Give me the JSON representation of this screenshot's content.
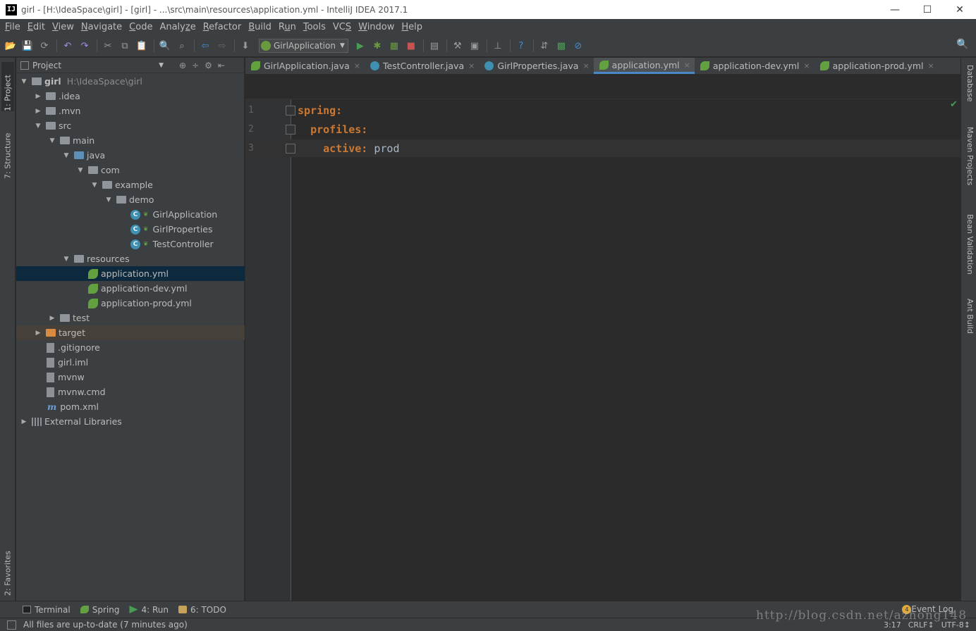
{
  "window": {
    "title": "girl - [H:\\IdeaSpace\\girl] - [girl] - ...\\src\\main\\resources\\application.yml - IntelliJ IDEA 2017.1",
    "app_icon_text": "IJ",
    "minimize": "—",
    "maximize": "☐",
    "close": "✕"
  },
  "menu": [
    {
      "mnemonic": "F",
      "rest": "ile"
    },
    {
      "mnemonic": "E",
      "rest": "dit"
    },
    {
      "mnemonic": "V",
      "rest": "iew"
    },
    {
      "mnemonic": "N",
      "rest": "avigate"
    },
    {
      "mnemonic": "C",
      "rest": "ode"
    },
    {
      "prefix": "Analy",
      "mnemonic": "z",
      "rest": "e"
    },
    {
      "mnemonic": "R",
      "rest": "efactor"
    },
    {
      "mnemonic": "B",
      "rest": "uild"
    },
    {
      "prefix": "R",
      "mnemonic": "u",
      "rest": "n"
    },
    {
      "mnemonic": "T",
      "rest": "ools"
    },
    {
      "prefix": "VC",
      "mnemonic": "S",
      "rest": ""
    },
    {
      "mnemonic": "W",
      "rest": "indow"
    },
    {
      "mnemonic": "H",
      "rest": "elp"
    }
  ],
  "toolbar": {
    "run_config": "GirlApplication",
    "icons": [
      "open-icon",
      "save-icon",
      "sync-icon",
      "undo-icon",
      "redo-icon",
      "cut-icon",
      "copy-icon",
      "paste-icon",
      "find-icon",
      "replace-icon",
      "back-icon",
      "forward-icon",
      "make-icon",
      "run-icon",
      "debug-icon",
      "coverage-icon",
      "stop-icon",
      "build-icon",
      "settings-icon",
      "structure-icon",
      "sdk-icon",
      "help-icon",
      "vcs-icon",
      "monitor-icon",
      "disable-icon",
      "search-everywhere-icon"
    ],
    "glyphs": {
      "open": "📂",
      "save": "💾",
      "sync": "⟳",
      "undo": "↶",
      "redo": "↷",
      "cut": "✂",
      "copy": "⧉",
      "paste": "📋",
      "find": "🔍",
      "replace": "⌕",
      "back": "⇦",
      "forward": "⇨",
      "make": "⬇",
      "run": "▶",
      "debug": "✱",
      "coverage": "▦",
      "stop": "■",
      "build": "▤",
      "settings": "⚒",
      "structure": "▣",
      "sdk": "⊥",
      "help": "?",
      "vcs": "⇵",
      "monitor": "▩",
      "disable": "⊘",
      "search": "🔍"
    }
  },
  "left_stripe": {
    "project": "1: Project",
    "structure": "7: Structure",
    "favorites": "2: Favorites"
  },
  "right_stripe": {
    "database": "Database",
    "maven": "Maven Projects",
    "bean": "Bean Validation",
    "ant": "Ant Build"
  },
  "project_panel": {
    "header": "Project",
    "dropdown": "▼",
    "tools": [
      "⊕",
      "÷",
      "⚙",
      "⇤"
    ],
    "tree": [
      {
        "label": "girl",
        "extra": "H:\\IdeaSpace\\girl",
        "indent": 0,
        "twisty": "▼",
        "icon": "folder"
      },
      {
        "label": ".idea",
        "indent": 1,
        "twisty": "▶",
        "icon": "folder"
      },
      {
        "label": ".mvn",
        "indent": 1,
        "twisty": "▶",
        "icon": "folder"
      },
      {
        "label": "src",
        "indent": 1,
        "twisty": "▼",
        "icon": "folder"
      },
      {
        "label": "main",
        "indent": 2,
        "twisty": "▼",
        "icon": "folder"
      },
      {
        "label": "java",
        "indent": 3,
        "twisty": "▼",
        "icon": "folder-blue"
      },
      {
        "label": "com",
        "indent": 4,
        "twisty": "▼",
        "icon": "folder"
      },
      {
        "label": "example",
        "indent": 5,
        "twisty": "▼",
        "icon": "folder"
      },
      {
        "label": "demo",
        "indent": 6,
        "twisty": "▼",
        "icon": "folder"
      },
      {
        "label": "GirlApplication",
        "indent": 7,
        "twisty": "",
        "icon": "spring-class"
      },
      {
        "label": "GirlProperties",
        "indent": 7,
        "twisty": "",
        "icon": "class"
      },
      {
        "label": "TestController",
        "indent": 7,
        "twisty": "",
        "icon": "class"
      },
      {
        "label": "resources",
        "indent": 3,
        "twisty": "▼",
        "icon": "folder-res"
      },
      {
        "label": "application.yml",
        "indent": 4,
        "twisty": "",
        "icon": "spring",
        "selected": true
      },
      {
        "label": "application-dev.yml",
        "indent": 4,
        "twisty": "",
        "icon": "spring"
      },
      {
        "label": "application-prod.yml",
        "indent": 4,
        "twisty": "",
        "icon": "spring"
      },
      {
        "label": "test",
        "indent": 2,
        "twisty": "▶",
        "icon": "folder"
      },
      {
        "label": "target",
        "indent": 1,
        "twisty": "▶",
        "icon": "folder-orange",
        "excluded": true
      },
      {
        "label": ".gitignore",
        "indent": 1,
        "twisty": "",
        "icon": "file"
      },
      {
        "label": "girl.iml",
        "indent": 1,
        "twisty": "",
        "icon": "file"
      },
      {
        "label": "mvnw",
        "indent": 1,
        "twisty": "",
        "icon": "file"
      },
      {
        "label": "mvnw.cmd",
        "indent": 1,
        "twisty": "",
        "icon": "file"
      },
      {
        "label": "pom.xml",
        "indent": 1,
        "twisty": "",
        "icon": "maven"
      },
      {
        "label": "External Libraries",
        "indent": 0,
        "twisty": "▶",
        "icon": "library"
      }
    ]
  },
  "editor_tabs": [
    {
      "label": "GirlApplication.java",
      "icon": "spring",
      "active": false
    },
    {
      "label": "TestController.java",
      "icon": "java",
      "active": false
    },
    {
      "label": "GirlProperties.java",
      "icon": "java",
      "active": false
    },
    {
      "label": "application.yml",
      "icon": "spring",
      "active": true
    },
    {
      "label": "application-dev.yml",
      "icon": "spring",
      "active": false
    },
    {
      "label": "application-prod.yml",
      "icon": "spring",
      "active": false
    }
  ],
  "tab_close": "×",
  "editor": {
    "line_numbers": [
      "1",
      "2",
      "3"
    ],
    "lines": [
      {
        "indent": "",
        "key": "spring:",
        "value": ""
      },
      {
        "indent": "  ",
        "key": "profiles:",
        "value": ""
      },
      {
        "indent": "    ",
        "key": "active:",
        "value": " prod"
      }
    ],
    "check": "✔"
  },
  "bottom_tools": [
    {
      "label": "Terminal",
      "icon": "terminal-icon"
    },
    {
      "label": "Spring",
      "icon": "spring-icon"
    },
    {
      "label": "4: Run",
      "icon": "run-icon"
    },
    {
      "label": "6: TODO",
      "icon": "todo-icon"
    }
  ],
  "event_log": {
    "count": "4",
    "label": "Event Log"
  },
  "status": {
    "message": "All files are up-to-date (7 minutes ago)",
    "position": "3:17",
    "line_sep": "CRLF↕",
    "encoding": "UTF-8↕"
  },
  "watermark": "http://blog.csdn.net/azhong148",
  "colors": {
    "bg": "#2b2b2b",
    "panel": "#3c3f41",
    "key": "#cc7832",
    "selected": "#0d293e",
    "spring_green": "#62a040",
    "java_blue": "#3f8fb3"
  }
}
